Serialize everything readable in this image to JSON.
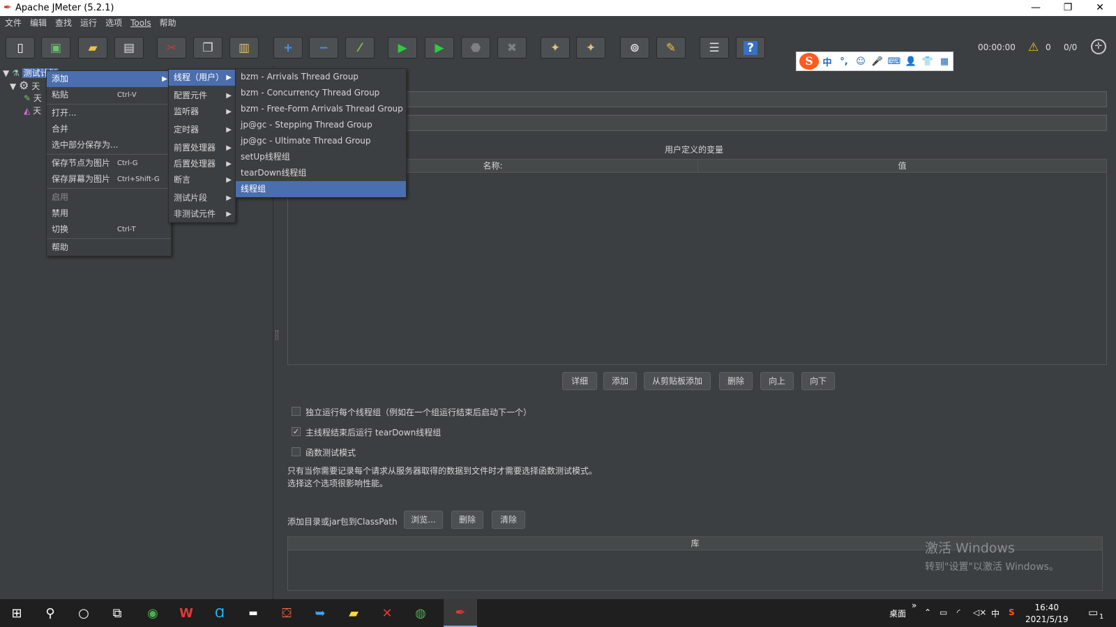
{
  "window": {
    "title": "Apache JMeter (5.2.1)",
    "minimize_glyph": "—",
    "restore_glyph": "❐",
    "close_glyph": "✕"
  },
  "menubar": [
    "文件",
    "编辑",
    "查找",
    "运行",
    "选项",
    "Tools",
    "帮助"
  ],
  "toolbar": {
    "icons": [
      "new-icon",
      "templates-icon",
      "open-icon",
      "save-icon",
      "cut-icon",
      "copy-icon",
      "paste-icon",
      "expand-icon",
      "collapse-icon",
      "toggle-icon",
      "start-icon",
      "start-no-timers-icon",
      "stop-icon",
      "shutdown-icon",
      "clear-icon",
      "clear-all-icon",
      "search-icon",
      "reset-search-icon",
      "function-helper-icon",
      "help-icon"
    ],
    "timer": "00:00:00",
    "warning_count": "0",
    "thread_ratio": "0/0"
  },
  "ime_bar": {
    "items": [
      "中",
      "°,",
      "☺",
      "🎤",
      "⌨",
      "👤",
      "👕",
      "▦"
    ]
  },
  "tree": {
    "root": "测试计划",
    "children": [
      "天",
      "天",
      "天"
    ]
  },
  "context_menu": {
    "items": [
      {
        "label": "添加",
        "shortcut": "",
        "submenu": true,
        "state": "highlighted"
      },
      {
        "label": "粘贴",
        "shortcut": "Ctrl-V"
      },
      {
        "label": "打开..."
      },
      {
        "label": "合并"
      },
      {
        "label": "选中部分保存为..."
      },
      {
        "label": "保存节点为图片",
        "shortcut": "Ctrl-G"
      },
      {
        "label": "保存屏幕为图片",
        "shortcut": "Ctrl+Shift-G"
      },
      {
        "label": "启用",
        "state": "disabled"
      },
      {
        "label": "禁用"
      },
      {
        "label": "切换",
        "shortcut": "Ctrl-T"
      },
      {
        "label": "帮助"
      }
    ]
  },
  "add_submenu": {
    "items": [
      "线程（用户）",
      "配置元件",
      "监听器",
      "定时器",
      "前置处理器",
      "后置处理器",
      "断言",
      "测试片段",
      "非测试元件"
    ]
  },
  "threads_submenu": {
    "items": [
      "bzm - Arrivals Thread Group",
      "bzm - Concurrency Thread Group",
      "bzm - Free-Form Arrivals Thread Group",
      "jp@gc - Stepping Thread Group",
      "jp@gc - Ultimate Thread Group",
      "setUp线程组",
      "tearDown线程组",
      "线程组"
    ]
  },
  "main": {
    "vars_title": "用户定义的变量",
    "vars_columns": [
      "名称:",
      "值"
    ],
    "vars_buttons": [
      "详细",
      "添加",
      "从剪贴板添加",
      "删除",
      "向上",
      "向下"
    ],
    "options": [
      {
        "label": "独立运行每个线程组（例如在一个组运行结束后启动下一个）",
        "checked": false
      },
      {
        "label": "主线程结束后运行 tearDown线程组",
        "checked": true
      },
      {
        "label": "函数测试模式",
        "checked": false
      }
    ],
    "note_line1": "只有当你需要记录每个请求从服务器取得的数据到文件时才需要选择函数测试模式。",
    "note_line2": "选择这个选项很影响性能。",
    "classpath_label": "添加目录或jar包到ClassPath",
    "classpath_buttons": [
      "浏览...",
      "删除",
      "清除"
    ],
    "lib_column": "库"
  },
  "watermark": {
    "line1": "激活 Windows",
    "line2": "转到\"设置\"以激活 Windows。"
  },
  "taskbar": {
    "apps": [
      "start-icon",
      "search-icon",
      "cortana-icon",
      "task-view-icon",
      "chrome-icon",
      "wps-icon",
      "browser-icon",
      "terminal-icon",
      "app-icon",
      "arrow-app-icon",
      "file-explorer-icon",
      "xmind-icon",
      "wechat-icon",
      "jmeter-icon"
    ],
    "desktop_label": "桌面",
    "chevron": "»",
    "ime_lang": "中",
    "time": "16:40",
    "date": "2021/5/19",
    "notification_count": "1"
  },
  "colors": {
    "accent": "#4b6eaf",
    "bg": "#3c3f41",
    "taskbar": "#1f1f1f"
  }
}
